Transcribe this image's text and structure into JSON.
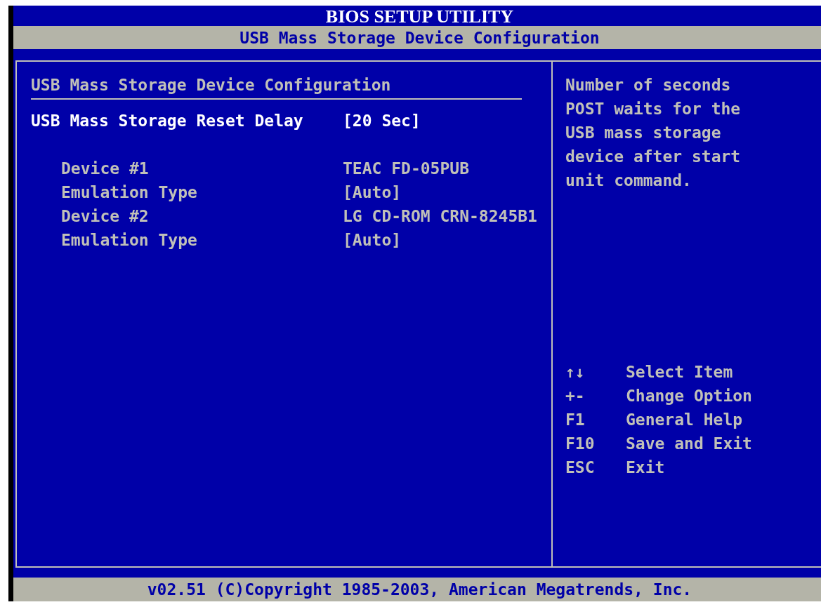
{
  "title": "BIOS SETUP UTILITY",
  "screen_title": "USB Mass Storage Device Configuration",
  "section_heading": "USB Mass Storage Device Configuration",
  "items": [
    {
      "kind": "option",
      "label": "USB Mass Storage Reset Delay",
      "value": "[20 Sec]",
      "selected": true
    },
    {
      "kind": "info",
      "label": "Device #1",
      "value": "TEAC FD-05PUB",
      "selected": false
    },
    {
      "kind": "info",
      "label": "Emulation Type",
      "value": "[Auto]",
      "selected": false
    },
    {
      "kind": "info",
      "label": "Device #2",
      "value": "LG CD-ROM CRN-8245B1",
      "selected": false
    },
    {
      "kind": "info",
      "label": "Emulation Type",
      "value": "[Auto]",
      "selected": false
    }
  ],
  "help_text": "Number of seconds POST waits for the USB mass storage device after start unit command.",
  "key_legend": [
    {
      "key": "↑↓",
      "action": "Select Item"
    },
    {
      "key": "+-",
      "action": "Change Option"
    },
    {
      "key": "F1",
      "action": "General Help"
    },
    {
      "key": "F10",
      "action": "Save and Exit"
    },
    {
      "key": "ESC",
      "action": "Exit"
    }
  ],
  "footer": "v02.51 (C)Copyright 1985-2003, American Megatrends, Inc."
}
